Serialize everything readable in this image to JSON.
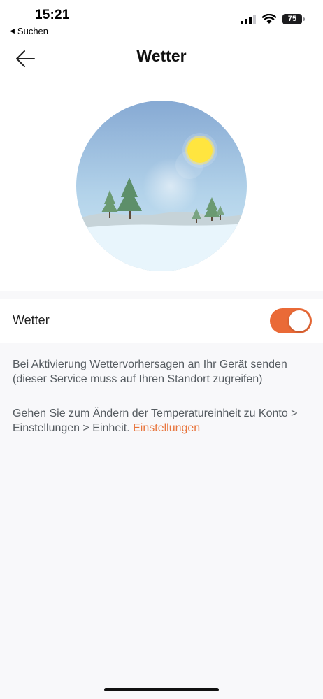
{
  "status_bar": {
    "time": "15:21",
    "back_app": "Suchen",
    "battery": "75"
  },
  "header": {
    "title": "Wetter",
    "back_icon": "arrow-left-icon"
  },
  "illustration": {
    "icon": "winter-weather-illustration",
    "colors": {
      "sky": "#8fb0d6",
      "sun": "#ffe24a",
      "snow": "#e8f4fb",
      "tree": "#5e8e66"
    }
  },
  "setting": {
    "label": "Wetter",
    "enabled": true,
    "toggle_color": "#ea6a37"
  },
  "description": {
    "text1": "Bei Aktivierung Wettervorhersagen an Ihr Gerät senden (dieser Service muss auf Ihren Standort zugreifen)",
    "text2": "Gehen Sie zum Ändern der Temperatureinheit zu Konto > Einstellungen > Einheit.",
    "link": "Einstellungen",
    "link_color": "#e8743b"
  }
}
